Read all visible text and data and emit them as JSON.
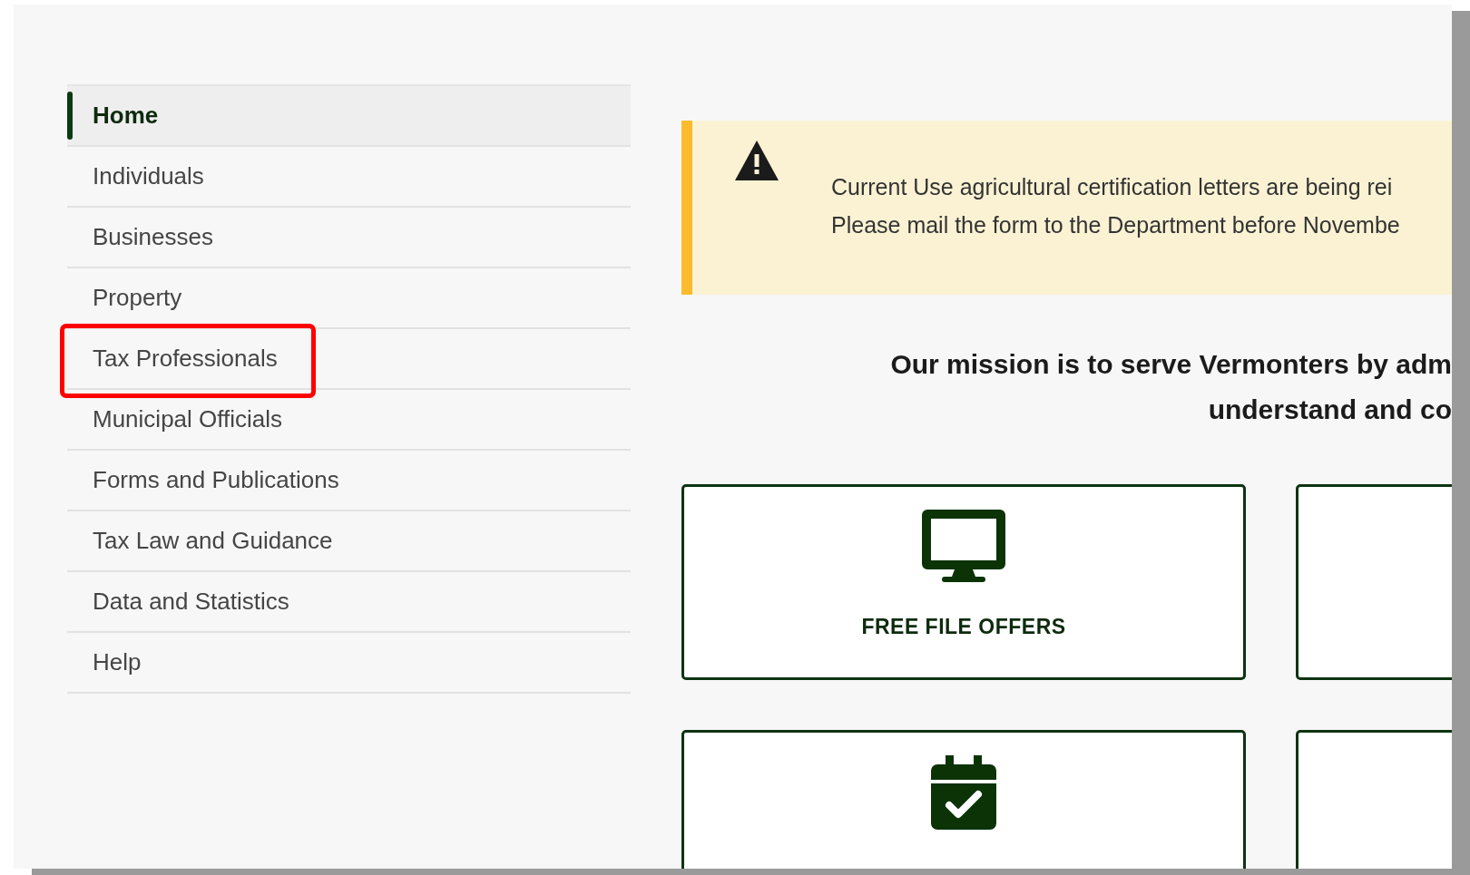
{
  "sidebar": {
    "items": [
      {
        "label": "Home",
        "selected": true,
        "highlighted": false
      },
      {
        "label": "Individuals",
        "selected": false,
        "highlighted": false
      },
      {
        "label": "Businesses",
        "selected": false,
        "highlighted": false
      },
      {
        "label": "Property",
        "selected": false,
        "highlighted": false
      },
      {
        "label": "Tax Professionals",
        "selected": false,
        "highlighted": true
      },
      {
        "label": "Municipal Officials",
        "selected": false,
        "highlighted": false
      },
      {
        "label": "Forms and Publications",
        "selected": false,
        "highlighted": false
      },
      {
        "label": "Tax Law and Guidance",
        "selected": false,
        "highlighted": false
      },
      {
        "label": "Data and Statistics",
        "selected": false,
        "highlighted": false
      },
      {
        "label": "Help",
        "selected": false,
        "highlighted": false
      }
    ]
  },
  "alert": {
    "kind": "warning",
    "lines": [
      "Current Use agricultural certification letters are being rei",
      "Please mail the form to the Department before Novembe"
    ]
  },
  "mission": {
    "lines": [
      "Our mission is to serve Vermonters by adm",
      "understand and co"
    ]
  },
  "cards": [
    {
      "kind": "monitor",
      "label": "FREE FILE OFFERS"
    },
    {
      "kind": "blank"
    },
    {
      "kind": "calendar"
    },
    {
      "kind": "blank"
    }
  ]
}
